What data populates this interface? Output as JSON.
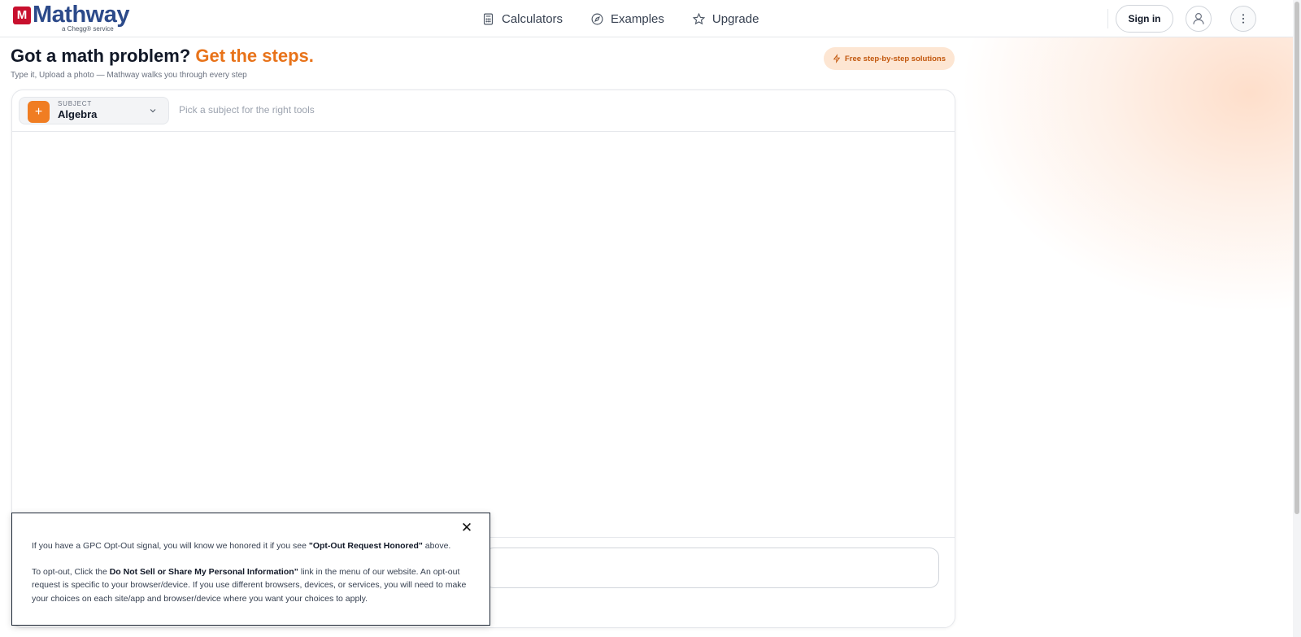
{
  "header": {
    "logo": {
      "name": "Mathway",
      "tagline": "a Chegg® service",
      "mark": "M"
    },
    "nav": [
      {
        "label": "Calculators",
        "icon": "calculator-icon"
      },
      {
        "label": "Examples",
        "icon": "compass-icon"
      },
      {
        "label": "Upgrade",
        "icon": "star-icon"
      }
    ],
    "sign_in_label": "Sign in",
    "user_icon": "user-icon",
    "more_icon": "more-vertical-icon"
  },
  "hero": {
    "title": "Got a math problem?",
    "title_accent": "Get the steps.",
    "subtitle": "Type it, Upload a photo — Mathway walks you through every step",
    "badge": "Free step-by-step solutions",
    "badge_icon": "lightning-icon"
  },
  "workspace": {
    "subject_label": "SUBJECT",
    "subject_value": "Algebra",
    "subject_icon": "plus-icon",
    "subject_hint": "Pick a subject for the right tools"
  },
  "consent": {
    "p1_before": "If you have a GPC Opt-Out signal, you will know we honored it if you see ",
    "p1_bold": "\"Opt-Out Request Honored\"",
    "p1_after": " above.",
    "p2_before": "To opt-out, Click the ",
    "p2_bold": "Do Not Sell or Share My Personal Information”",
    "p2_after": " link in the menu of our website. An opt-out request is specific to your browser/device. If you use different browsers, devices, or services, you will need to make your choices on each site/app and browser/device where you want your choices to apply.",
    "close_icon": "close-icon"
  },
  "colors": {
    "accent": "#e8731a",
    "brand_blue": "#2c4a8a",
    "brand_red": "#c8102e",
    "badge_bg": "#fde6d3"
  }
}
